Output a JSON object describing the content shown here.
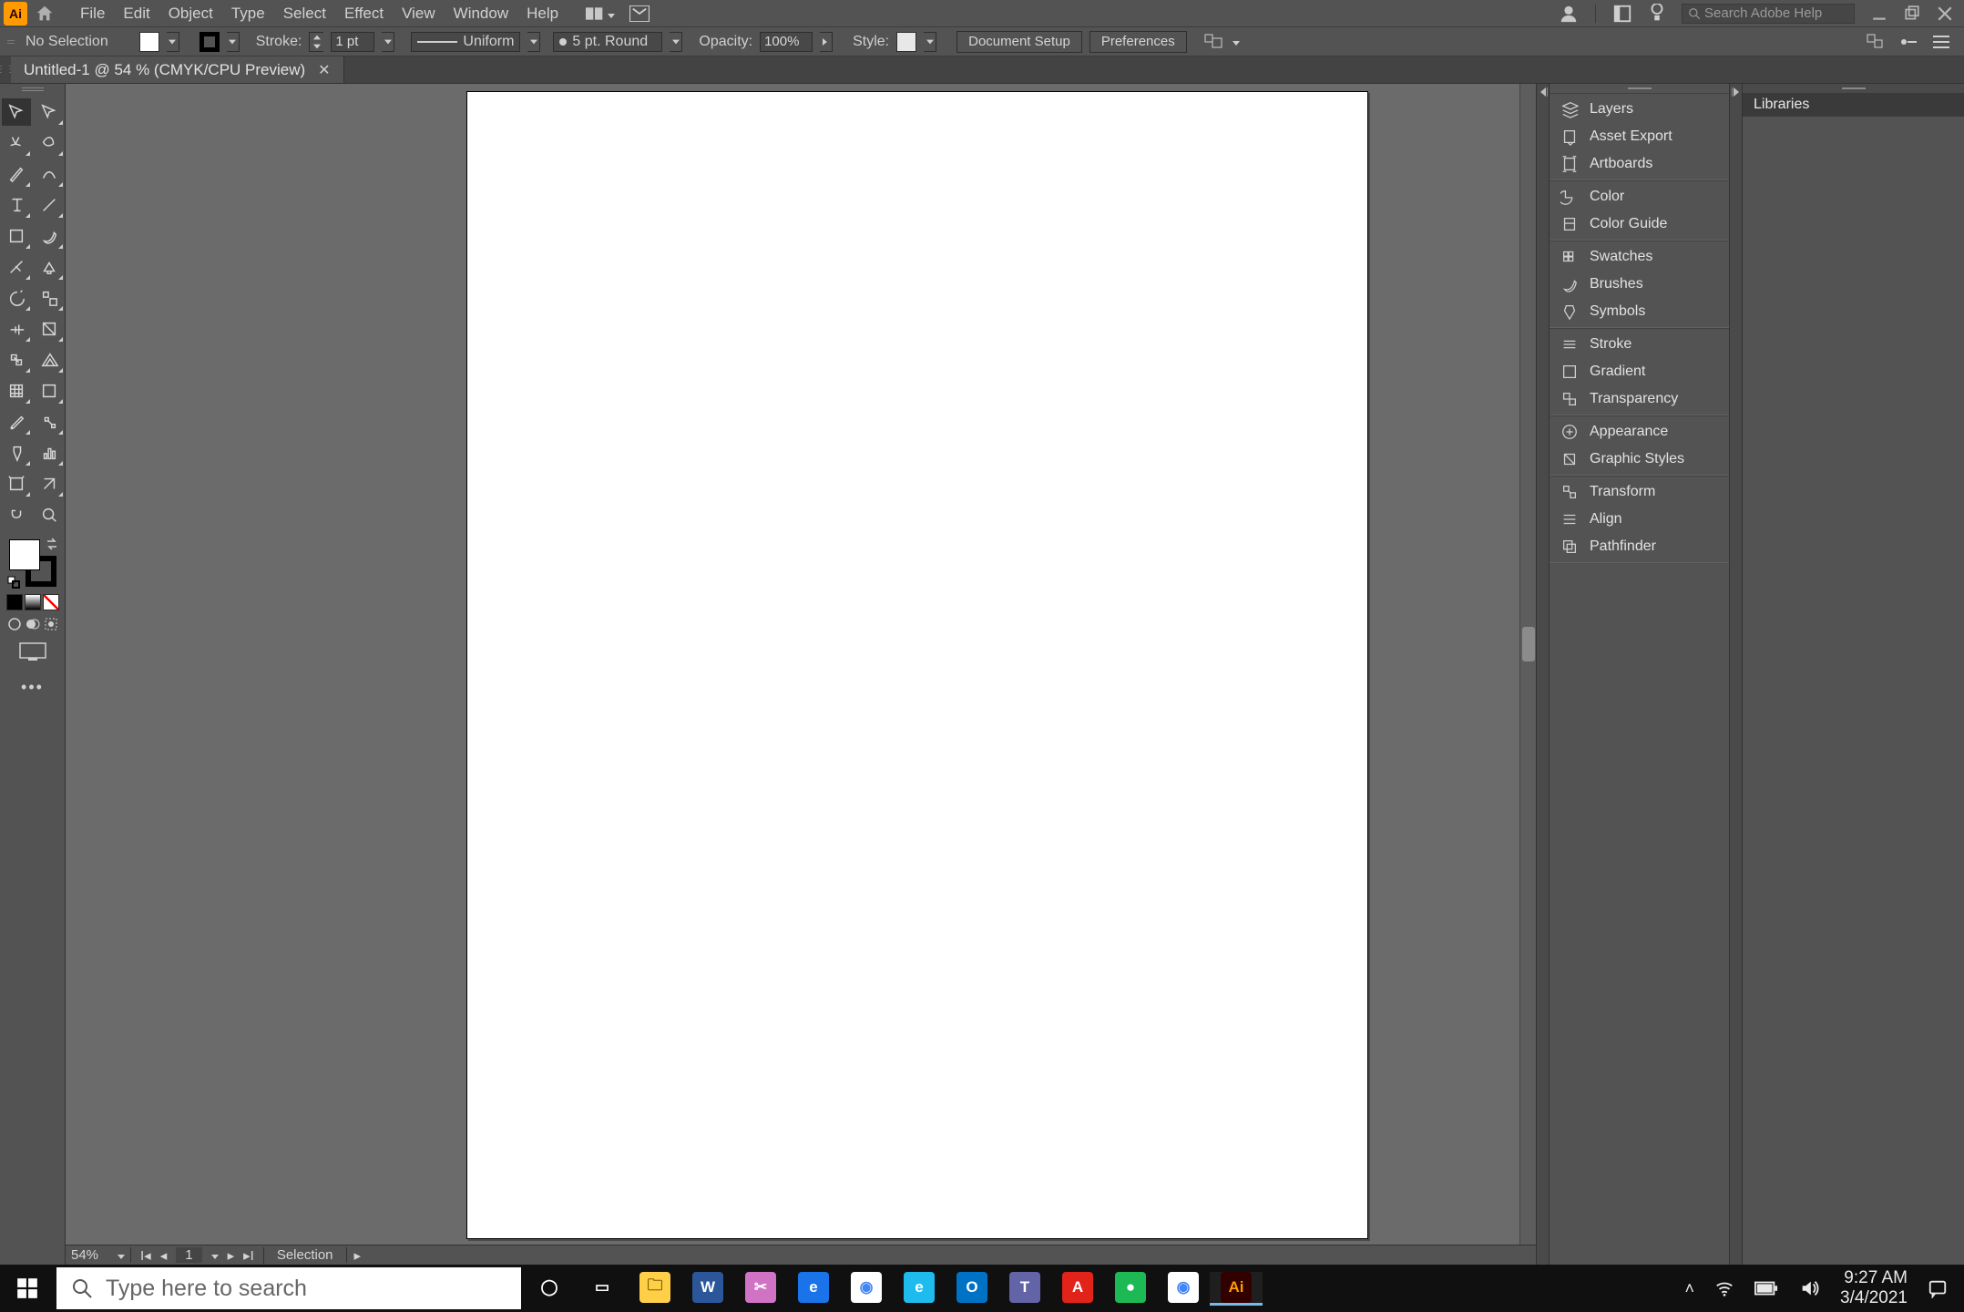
{
  "menubar": {
    "items": [
      "File",
      "Edit",
      "Object",
      "Type",
      "Select",
      "Effect",
      "View",
      "Window",
      "Help"
    ],
    "search_placeholder": "Search Adobe Help"
  },
  "controlbar": {
    "selection": "No Selection",
    "stroke_label": "Stroke:",
    "stroke_value": "1 pt",
    "brush_def": "Uniform",
    "var_width": "5 pt. Round",
    "opacity_label": "Opacity:",
    "opacity_value": "100%",
    "style_label": "Style:",
    "doc_setup": "Document Setup",
    "prefs": "Preferences"
  },
  "tab": {
    "title": "Untitled-1 @ 54 % (CMYK/CPU Preview)"
  },
  "dock_groups": [
    [
      "Layers",
      "Asset Export",
      "Artboards"
    ],
    [
      "Color",
      "Color Guide"
    ],
    [
      "Swatches",
      "Brushes",
      "Symbols"
    ],
    [
      "Stroke",
      "Gradient",
      "Transparency"
    ],
    [
      "Appearance",
      "Graphic Styles"
    ],
    [
      "Transform",
      "Align",
      "Pathfinder"
    ]
  ],
  "libraries": {
    "tab": "Libraries"
  },
  "status": {
    "zoom": "54%",
    "artboard_no": "1",
    "current_tool": "Selection"
  },
  "taskbar": {
    "search_placeholder": "Type here to search",
    "time": "9:27 AM",
    "date": "3/4/2021"
  },
  "tool_names": [
    "selection-tool",
    "direct-selection-tool",
    "magic-wand-tool",
    "lasso-tool",
    "pen-tool",
    "curvature-tool",
    "type-tool",
    "line-segment-tool",
    "rectangle-tool",
    "paintbrush-tool",
    "shaper-tool",
    "eraser-tool",
    "rotate-tool",
    "scale-tool",
    "width-tool",
    "free-transform-tool",
    "shape-builder-tool",
    "perspective-grid-tool",
    "mesh-tool",
    "gradient-tool",
    "eyedropper-tool",
    "blend-tool",
    "symbol-sprayer-tool",
    "column-graph-tool",
    "artboard-tool",
    "slice-tool",
    "hand-tool",
    "zoom-tool"
  ],
  "taskbar_apps": [
    {
      "name": "cortana",
      "bg": "#101010",
      "fg": "#fff",
      "label": "◯"
    },
    {
      "name": "task-view",
      "bg": "#101010",
      "fg": "#fff",
      "label": "▭"
    },
    {
      "name": "file-explorer",
      "bg": "#ffcf48",
      "fg": "#7a5b00",
      "label": "🗀"
    },
    {
      "name": "word",
      "bg": "#2b579a",
      "fg": "#fff",
      "label": "W"
    },
    {
      "name": "snip",
      "bg": "#d173c5",
      "fg": "#fff",
      "label": "✂"
    },
    {
      "name": "edge-legacy",
      "bg": "#1a73e8",
      "fg": "#fff",
      "label": "e"
    },
    {
      "name": "chrome",
      "bg": "#fff",
      "fg": "#4285f4",
      "label": "◉"
    },
    {
      "name": "ie",
      "bg": "#1ebbee",
      "fg": "#fff",
      "label": "e"
    },
    {
      "name": "outlook",
      "bg": "#0072c6",
      "fg": "#fff",
      "label": "O"
    },
    {
      "name": "teams",
      "bg": "#6264a7",
      "fg": "#fff",
      "label": "T"
    },
    {
      "name": "acrobat",
      "bg": "#e2231a",
      "fg": "#fff",
      "label": "A"
    },
    {
      "name": "spotify",
      "bg": "#1db954",
      "fg": "#fff",
      "label": "●"
    },
    {
      "name": "chrome2",
      "bg": "#fff",
      "fg": "#4285f4",
      "label": "◉"
    },
    {
      "name": "illustrator",
      "bg": "#330000",
      "fg": "#ff9a00",
      "label": "Ai"
    }
  ]
}
